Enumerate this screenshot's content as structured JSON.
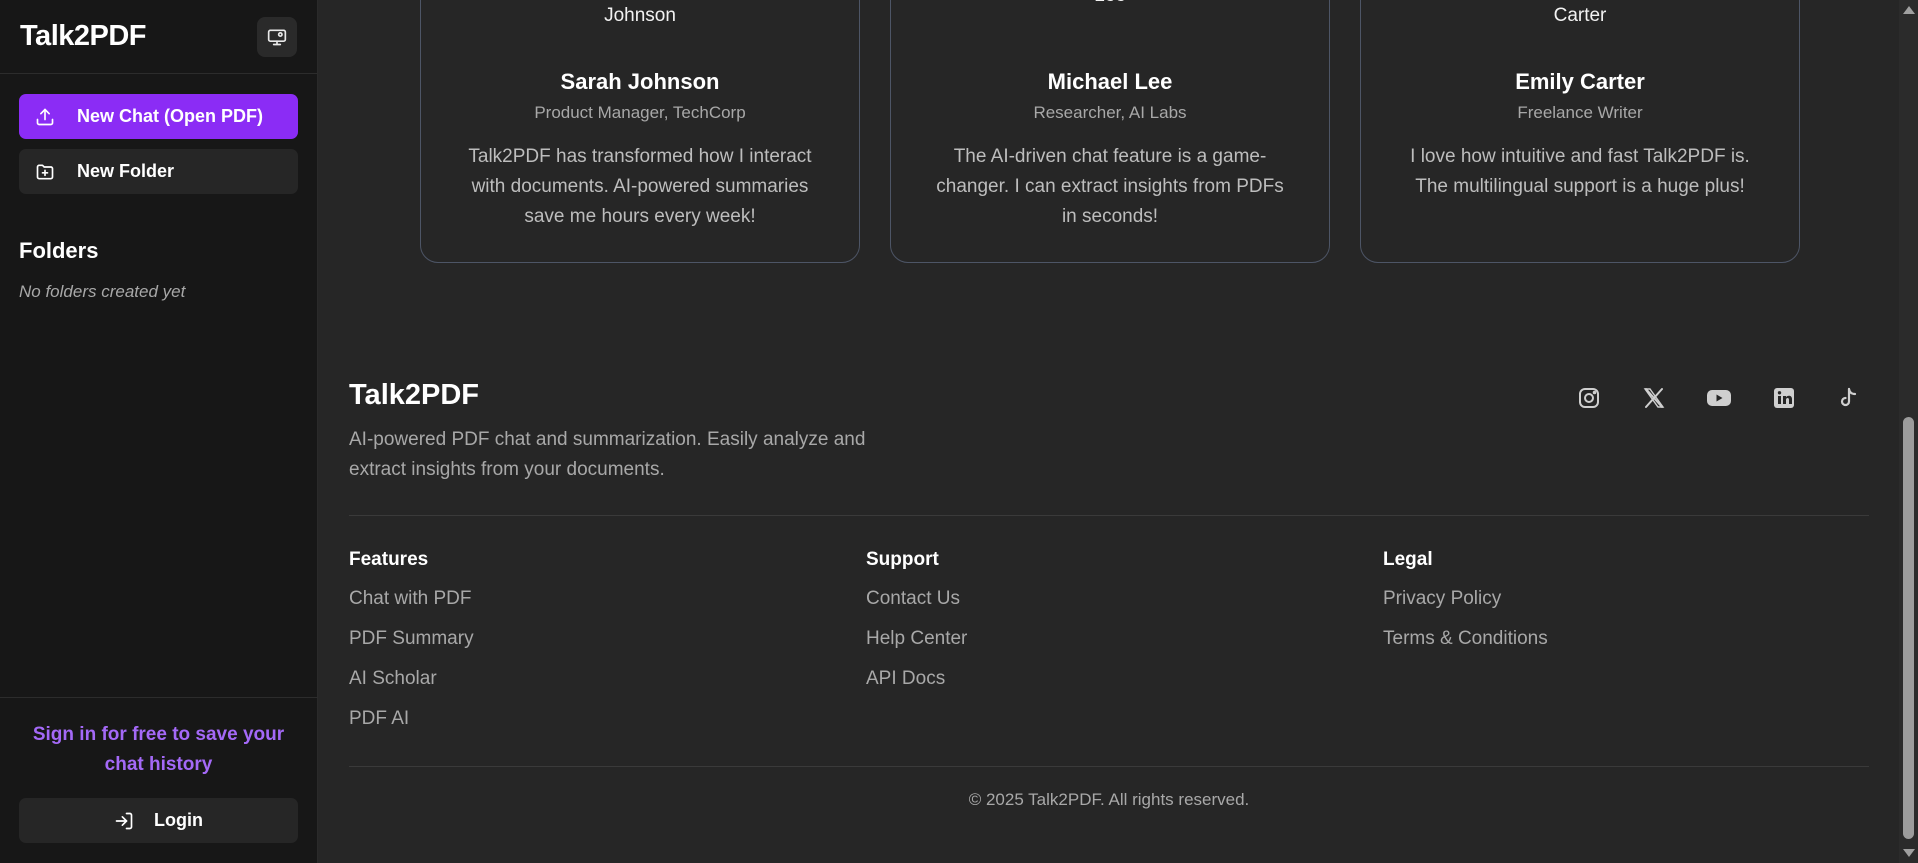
{
  "sidebar": {
    "brand": "Talk2PDF",
    "new_chat_label": "New Chat (Open PDF)",
    "new_folder_label": "New Folder",
    "folders_title": "Folders",
    "folders_empty": "No folders created yet",
    "signin_text": "Sign in for free to save your chat history",
    "login_label": "Login",
    "accent": "#8b2cf5"
  },
  "testimonials": [
    {
      "top_name": "Johnson",
      "name": "Sarah Johnson",
      "role": "Product Manager, TechCorp",
      "quote": "Talk2PDF has transformed how I interact with documents. AI-powered summaries save me hours every week!"
    },
    {
      "top_name": "Michael\nLee",
      "name": "Michael Lee",
      "role": "Researcher, AI Labs",
      "quote": "The AI-driven chat feature is a game-changer. I can extract insights from PDFs in seconds!"
    },
    {
      "top_name": "Carter",
      "name": "Emily Carter",
      "role": "Freelance Writer",
      "quote": "I love how intuitive and fast Talk2PDF is. The multilingual support is a huge plus!"
    }
  ],
  "footer": {
    "brand": "Talk2PDF",
    "description": "AI-powered PDF chat and summarization. Easily analyze and extract insights from your documents.",
    "socials": [
      "instagram-icon",
      "x-icon",
      "youtube-icon",
      "linkedin-icon",
      "tiktok-icon"
    ],
    "columns": [
      {
        "title": "Features",
        "links": [
          "Chat with PDF",
          "PDF Summary",
          "AI Scholar",
          "PDF AI"
        ]
      },
      {
        "title": "Support",
        "links": [
          "Contact Us",
          "Help Center",
          "API Docs"
        ]
      },
      {
        "title": "Legal",
        "links": [
          "Privacy Policy",
          "Terms & Conditions"
        ]
      }
    ],
    "copyright": "© 2025 Talk2PDF. All rights reserved."
  }
}
